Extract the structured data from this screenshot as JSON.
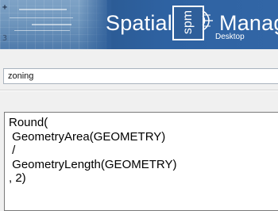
{
  "banner": {
    "title_left": "Spatial",
    "logo_text": "spm",
    "title_right": "Manag",
    "subtitle": "Desktop",
    "logo_icon": "globe-icon",
    "map_glyphs": [
      "+",
      "3"
    ]
  },
  "name_field": {
    "value": "zoning"
  },
  "expression": {
    "text": "Round(\n GeometryArea(GEOMETRY)\n /\n GeometryLength(GEOMETRY)\n, 2)"
  },
  "colors": {
    "banner_blue": "#2f5f9a",
    "banner_text": "#ffffff",
    "window_bg": "#f0f0f0"
  }
}
